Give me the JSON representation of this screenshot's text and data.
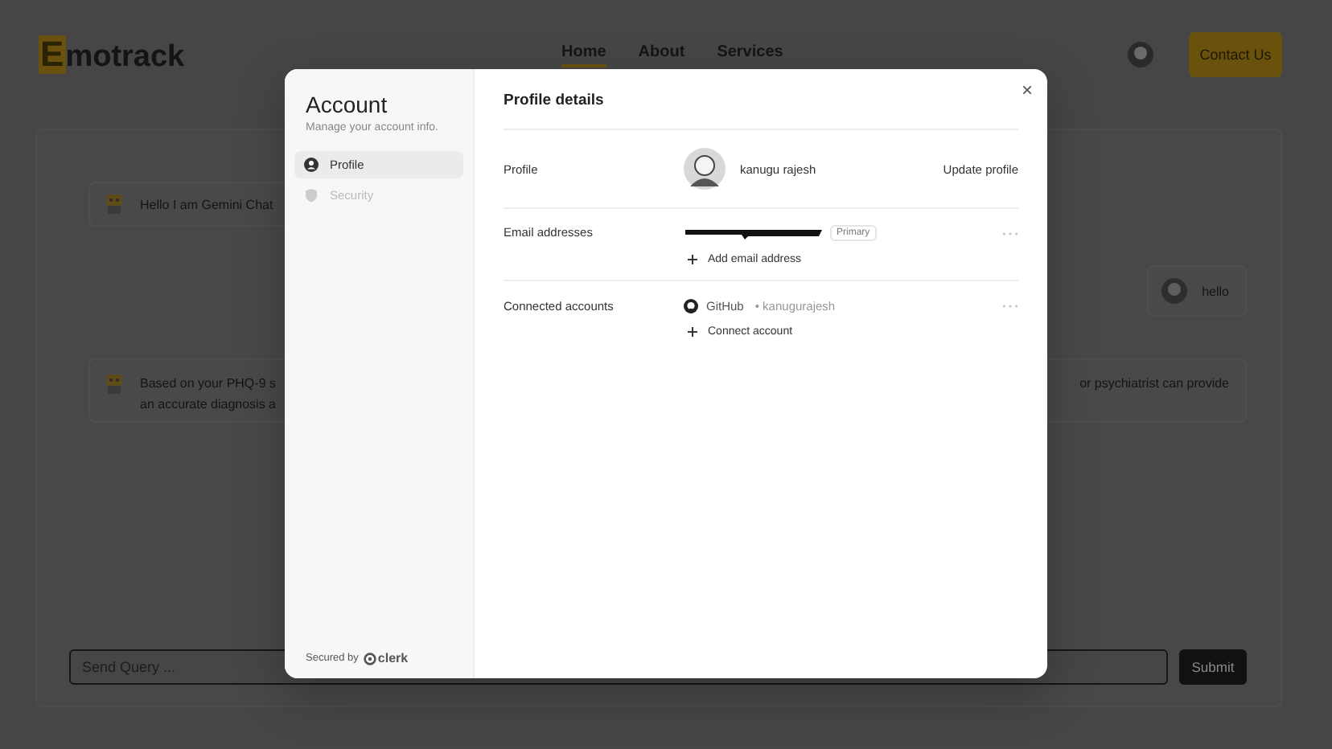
{
  "nav": {
    "logo": {
      "initial": "E",
      "rest": "motrack"
    },
    "links": [
      {
        "label": "Home",
        "selected": true
      },
      {
        "label": "About",
        "selected": false
      },
      {
        "label": "Services",
        "selected": false
      }
    ],
    "contact_button": "Contact Us"
  },
  "chat": {
    "messages": [
      {
        "kind": "bot",
        "lines_left": [
          "Hello I am Gemini Chat"
        ]
      },
      {
        "kind": "user",
        "lines_left": [
          "hello"
        ]
      },
      {
        "kind": "bot",
        "lines_left": [
          "Based on your PHQ-9 s",
          "an accurate diagnosis a"
        ],
        "lines_right": [
          "or psychiatrist can provide"
        ]
      }
    ],
    "input": {
      "placeholder": "Send Query ..."
    },
    "submit": "Submit"
  },
  "modal": {
    "sidebar": {
      "title": "Account",
      "subtitle": "Manage your account info.",
      "items": [
        {
          "label": "Profile",
          "selected": true
        },
        {
          "label": "Security",
          "selected": false
        }
      ],
      "footer": {
        "text": "Secured by",
        "brand": "clerk"
      }
    },
    "title": "Profile details",
    "close": "×",
    "sections": [
      {
        "kind": "profile",
        "label": "Profile",
        "name": "kanugu rajesh",
        "action": "Update profile"
      },
      {
        "kind": "email",
        "label": "Email addresses",
        "badge": "Primary",
        "add": "Add email address"
      },
      {
        "kind": "connected",
        "label": "Connected accounts",
        "provider": "GitHub",
        "username": "• kanugurajesh",
        "add": "Connect account"
      }
    ]
  }
}
